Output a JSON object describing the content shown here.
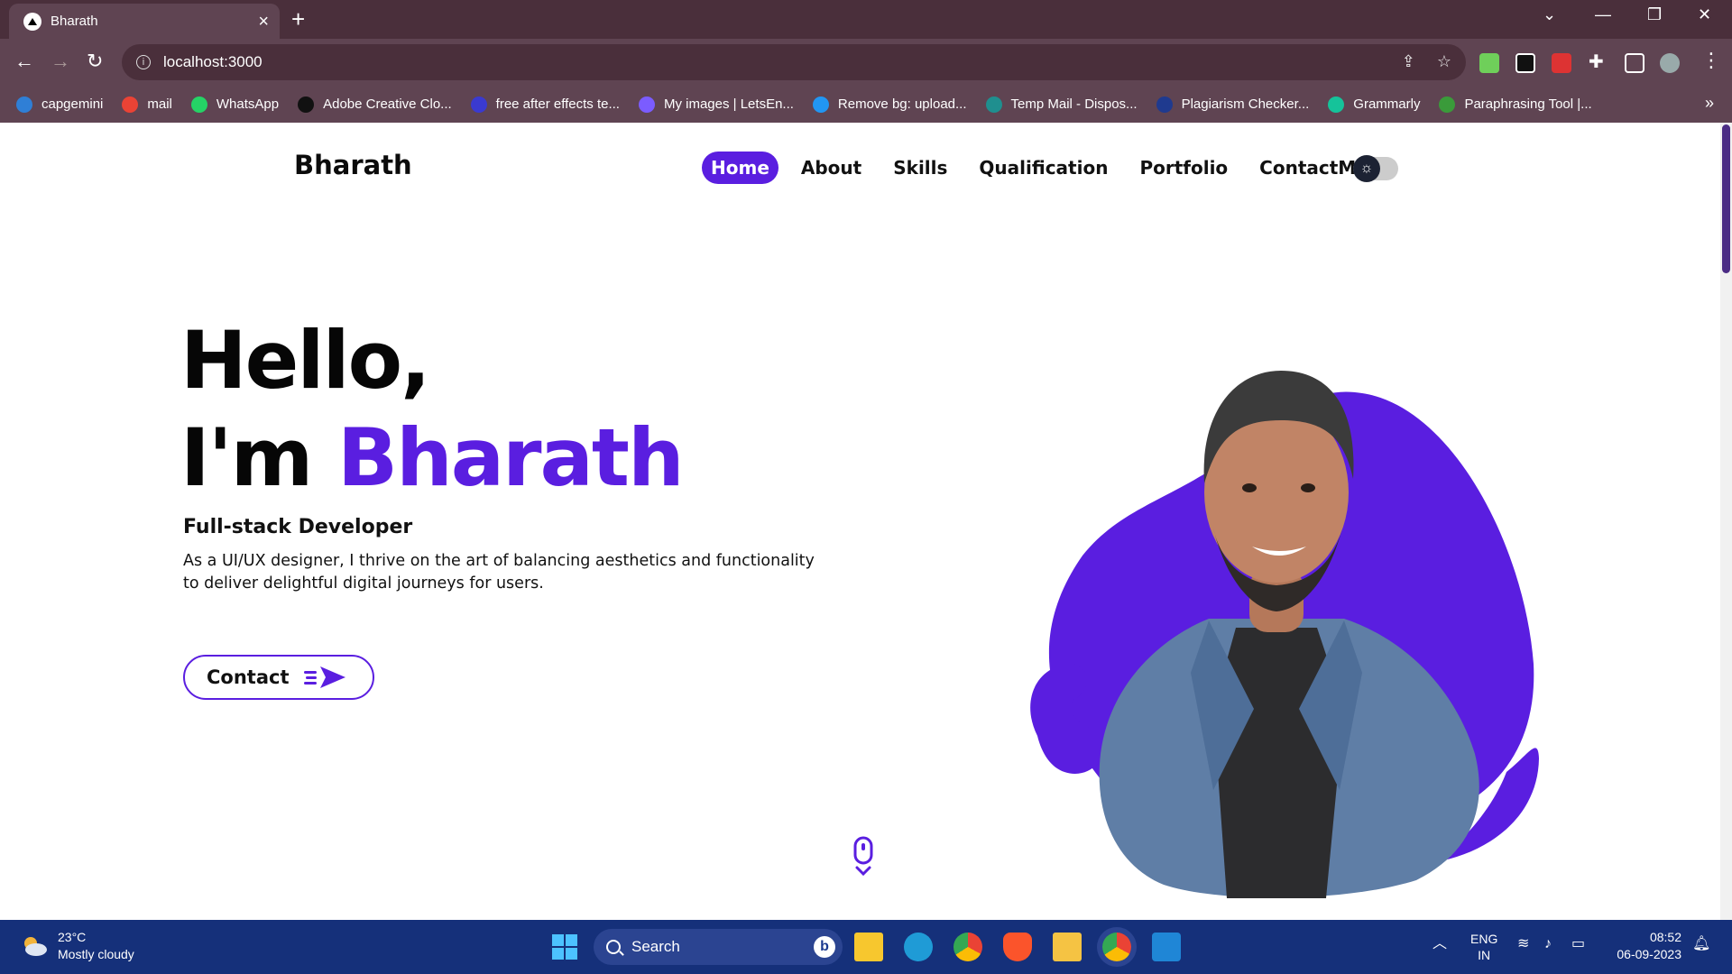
{
  "browser": {
    "tab_title": "Bharath",
    "new_tab_symbol": "+",
    "address": "localhost:3000",
    "bookmarks": [
      {
        "label": "capgemini",
        "color": "#2f7fd6"
      },
      {
        "label": "mail",
        "color": "#ea4335"
      },
      {
        "label": "WhatsApp",
        "color": "#25d366"
      },
      {
        "label": "Adobe Creative Clo...",
        "color": "#111111"
      },
      {
        "label": "free after effects te...",
        "color": "#3a3ad0"
      },
      {
        "label": "My images | LetsEn...",
        "color": "#7b5cff"
      },
      {
        "label": "Remove bg: upload...",
        "color": "#2196f3"
      },
      {
        "label": "Temp Mail - Dispos...",
        "color": "#1f8f8f"
      },
      {
        "label": "Plagiarism Checker...",
        "color": "#1f3a8f"
      },
      {
        "label": "Grammarly",
        "color": "#15c39a"
      },
      {
        "label": "Paraphrasing Tool |...",
        "color": "#3a9b3a"
      }
    ],
    "more_bookmarks": "»"
  },
  "site": {
    "logo": "Bharath",
    "nav": [
      {
        "label": "Home",
        "active": true
      },
      {
        "label": "About",
        "active": false
      },
      {
        "label": "Skills",
        "active": false
      },
      {
        "label": "Qualification",
        "active": false
      },
      {
        "label": "Portfolio",
        "active": false
      },
      {
        "label": "ContactMe",
        "active": false
      }
    ],
    "theme_toggle_icon": "sun-icon",
    "accent_color": "#5a1ee0"
  },
  "hero": {
    "greeting": "Hello,",
    "intro_prefix": "I'm ",
    "name": "Bharath",
    "role": "Full-stack Developer",
    "description": "As a UI/UX designer, I thrive on the art of balancing aesthetics and functionality to deliver delightful digital journeys for users.",
    "contact_button": "Contact"
  },
  "taskbar": {
    "weather_temp": "23°C",
    "weather_desc": "Mostly cloudy",
    "search_placeholder": "Search",
    "bing_label": "b",
    "lang_top": "ENG",
    "lang_bottom": "IN",
    "time": "08:52",
    "date": "06-09-2023"
  }
}
